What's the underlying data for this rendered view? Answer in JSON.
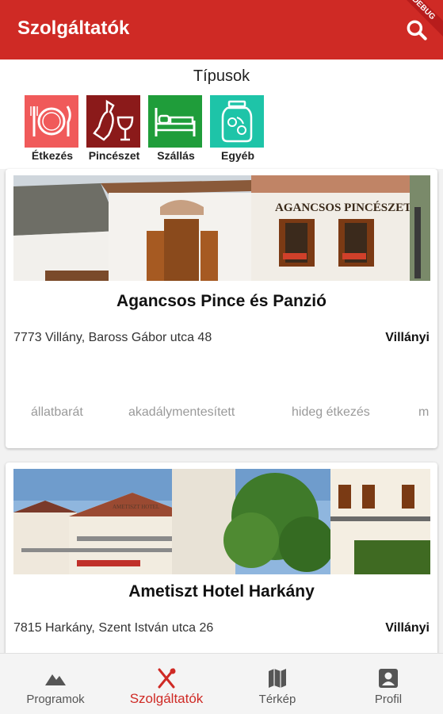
{
  "appbar": {
    "title": "Szolgáltatók",
    "debug_label": "DEBUG"
  },
  "types": {
    "title": "Típusok",
    "items": [
      {
        "label": "Étkezés",
        "color": "#f05a5a",
        "icon": "plate-cutlery-icon"
      },
      {
        "label": "Pincészet",
        "color": "#8b1a1a",
        "icon": "wine-bottle-glass-icon"
      },
      {
        "label": "Szállás",
        "color": "#1f9d3a",
        "icon": "bed-icon"
      },
      {
        "label": "Egyéb",
        "color": "#1ec4a8",
        "icon": "jar-icon"
      }
    ]
  },
  "cards": [
    {
      "name": "Agancsos Pince és Panzió",
      "address": "7773 Villány, Baross Gábor utca 48",
      "region": "Villányi",
      "sign_text": "AGANCSOS PINCÉSZET",
      "tags": [
        "állatbarát",
        "akadálymentesített",
        "hideg étkezés",
        "m"
      ]
    },
    {
      "name": "Ametiszt Hotel Harkány",
      "address": "7815 Harkány, Szent István utca 26",
      "region": "Villányi",
      "sign_text": "AMETISZT HOTEL"
    }
  ],
  "bottom_nav": {
    "items": [
      {
        "label": "Programok",
        "icon": "mountain-icon"
      },
      {
        "label": "Szolgáltatók",
        "icon": "utensils-cross-icon"
      },
      {
        "label": "Térkép",
        "icon": "map-icon"
      },
      {
        "label": "Profil",
        "icon": "profile-card-icon"
      }
    ],
    "active_color": "#cf2a25"
  }
}
